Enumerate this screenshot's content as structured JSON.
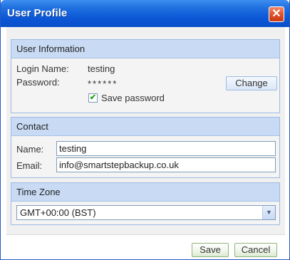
{
  "window": {
    "title": "User Profile",
    "close_icon": "close-icon"
  },
  "user_info": {
    "header": "User Information",
    "login_label": "Login Name:",
    "login_value": "testing",
    "password_label": "Password:",
    "password_value": "******",
    "change_label": "Change",
    "save_password_label": "Save password",
    "save_password_checked": true
  },
  "contact": {
    "header": "Contact",
    "name_label": "Name:",
    "name_value": "testing",
    "email_label": "Email:",
    "email_value": "info@smartstepbackup.co.uk"
  },
  "timezone": {
    "header": "Time Zone",
    "selected": "GMT+00:00 (BST)"
  },
  "actions": {
    "save_label": "Save",
    "cancel_label": "Cancel"
  },
  "colors": {
    "titlebar": "#0b56d6",
    "section_header": "#c8daf4",
    "close_button": "#e0502a",
    "check": "#21a121"
  }
}
